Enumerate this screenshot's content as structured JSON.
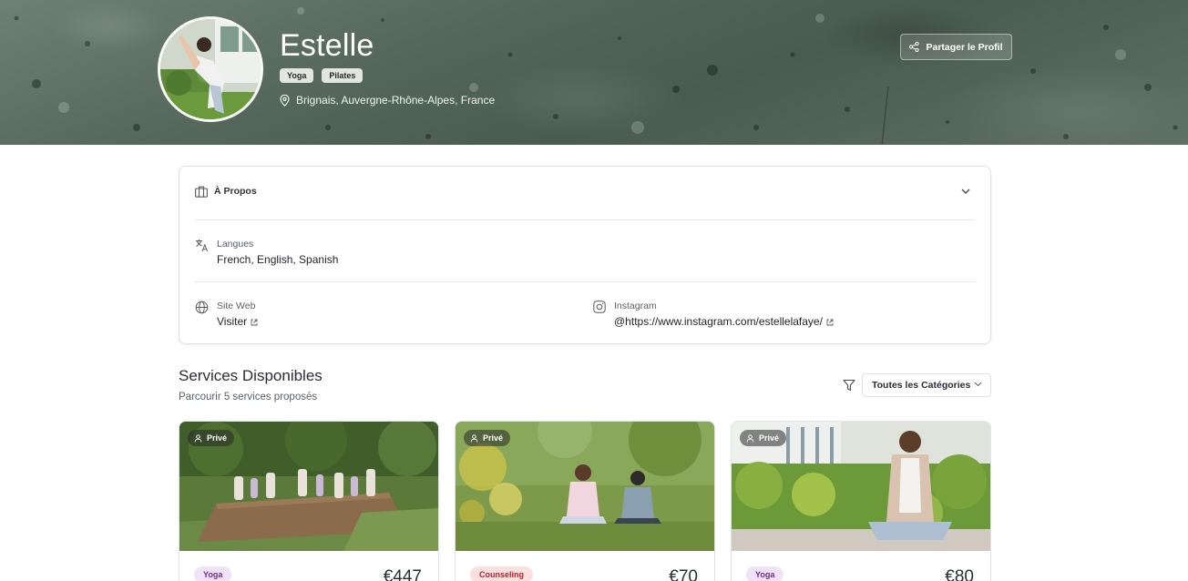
{
  "profile": {
    "name": "Estelle",
    "tags": [
      "Yoga",
      "Pilates"
    ],
    "location": "Brignais, Auvergne-Rhône-Alpes, France",
    "share_label": "Partager le Profil"
  },
  "about": {
    "title": "À Propos",
    "languages_label": "Langues",
    "languages_value": "French, English, Spanish",
    "website_label": "Site Web",
    "website_value": "Visiter",
    "instagram_label": "Instagram",
    "instagram_value": "@https://www.instagram.com/estellelafaye/"
  },
  "services": {
    "title": "Services Disponibles",
    "subtitle": "Parcourir 5 services proposés",
    "category_filter": "Toutes les Catégories",
    "items": [
      {
        "badge": "Privé",
        "category": "Yoga",
        "price": "€447"
      },
      {
        "badge": "Privé",
        "category": "Counseling",
        "price": "€70"
      },
      {
        "badge": "Privé",
        "category": "Yoga",
        "price": "€80"
      }
    ]
  },
  "colors": {
    "hero_green": "#55675b",
    "yoga_tag_bg": "#f0e3f7",
    "yoga_tag_text": "#6f2b8c",
    "counseling_tag_bg": "#fbe0e0",
    "counseling_tag_text": "#b0242e"
  }
}
